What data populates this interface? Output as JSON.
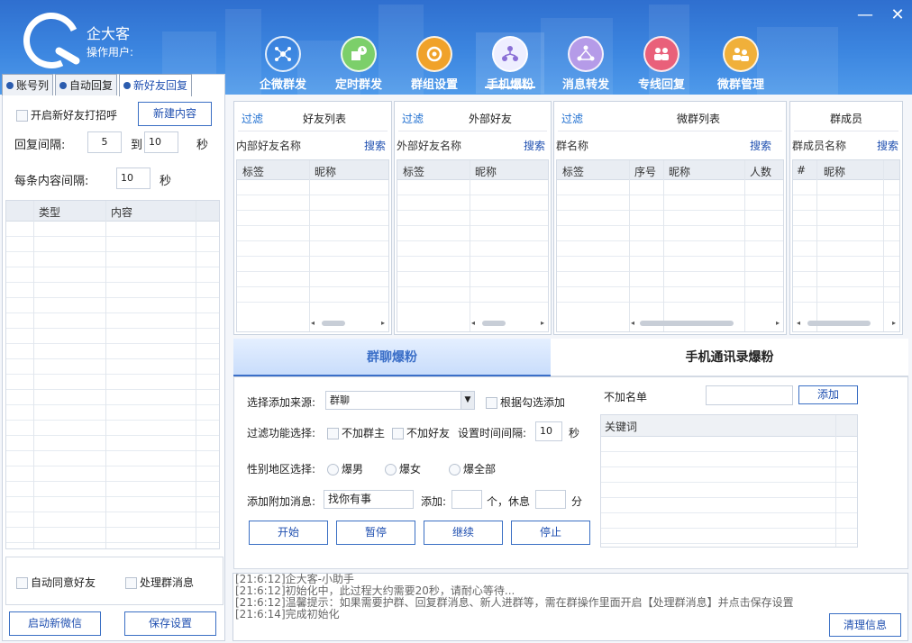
{
  "app": {
    "name": "企大客",
    "operator_label": "操作用户:"
  },
  "window": {
    "minimize": "—",
    "close": "✕"
  },
  "nav": [
    {
      "label": "企微群发",
      "icon": "share-network-icon"
    },
    {
      "label": "定时群发",
      "icon": "schedule-box-icon"
    },
    {
      "label": "群组设置",
      "icon": "group-settings-icon"
    },
    {
      "label": "手机爆粉",
      "icon": "org-tree-icon",
      "active": true
    },
    {
      "label": "消息转发",
      "icon": "forward-cycle-icon"
    },
    {
      "label": "专线回复",
      "icon": "people-reply-icon"
    },
    {
      "label": "微群管理",
      "icon": "group-manage-icon"
    }
  ],
  "left": {
    "tabs": [
      "账号列",
      "自动回复",
      "新好友回复"
    ],
    "enable_greeting": "开启新好友打招呼",
    "new_content_btn": "新建内容",
    "reply_interval_label": "回复间隔:",
    "reply_from": "5",
    "to_label": "到",
    "reply_to": "10",
    "sec": "秒",
    "item_interval_label": "每条内容间隔:",
    "item_interval": "10",
    "grid_cols": [
      "类型",
      "内容"
    ],
    "auto_accept": "自动同意好友",
    "handle_group_msg": "处理群消息",
    "start_wechat_btn": "启动新微信",
    "save_settings_btn": "保存设置"
  },
  "panels": {
    "friends": {
      "filter": "过滤",
      "title": "好友列表",
      "search_label": "内部好友名称",
      "search": "搜索",
      "cols": [
        "标签",
        "昵称"
      ]
    },
    "external": {
      "filter": "过滤",
      "title": "外部好友",
      "search_label": "外部好友名称",
      "search": "搜索",
      "cols": [
        "标签",
        "昵称"
      ]
    },
    "groups": {
      "filter": "过滤",
      "title": "微群列表",
      "search_label": "群名称",
      "search": "搜索",
      "cols": [
        "标签",
        "序号",
        "昵称",
        "人数"
      ]
    },
    "members": {
      "title": "群成员",
      "search_label": "群成员名称",
      "search": "搜索",
      "cols": [
        "#",
        "昵称"
      ]
    }
  },
  "mode_tabs": {
    "group": "群聊爆粉",
    "contacts": "手机通讯录爆粉"
  },
  "form": {
    "source_label": "选择添加来源:",
    "source_value": "群聊",
    "by_check": "根据勾选添加",
    "filter_label": "过滤功能选择:",
    "no_owner": "不加群主",
    "no_friend": "不加好友",
    "time_interval_label": "设置时间间隔:",
    "time_interval": "10",
    "sec": "秒",
    "gender_label": "性别地区选择:",
    "male": "爆男",
    "female": "爆女",
    "all": "爆全部",
    "extra_msg_label": "添加附加消息:",
    "extra_msg": "找你有事",
    "add_label": "添加:",
    "unit": "个，休息",
    "minute": "分",
    "start": "开始",
    "pause": "暂停",
    "resume": "继续",
    "stop": "停止",
    "blacklist_label": "不加名单",
    "add_btn": "添加",
    "keyword_col": "关键词"
  },
  "log": {
    "lines": [
      "[21:6:12]企大客-小助手",
      "[21:6:12]初始化中，此过程大约需要20秒，请耐心等待...",
      "[21:6:12]温馨提示：如果需要护群、回复群消息、新人进群等，需在群操作里面开启【处理群消息】并点击保存设置",
      "[21:6:14]完成初始化"
    ],
    "clear_btn": "清理信息"
  }
}
